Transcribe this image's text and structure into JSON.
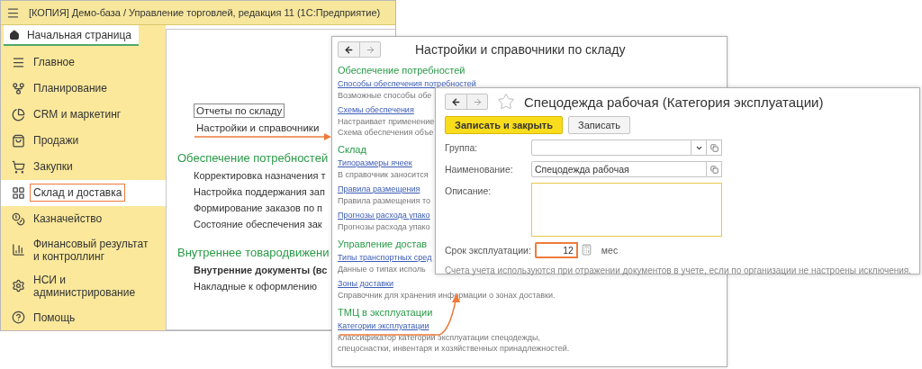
{
  "main_window": {
    "title": "[КОПИЯ] Демо-база / Управление торговлей, редакция 11  (1С:Предприятие)",
    "home_tab": {
      "label": "Начальная страница",
      "selected": true
    },
    "sidebar": {
      "items": [
        {
          "label": "Главное",
          "selected": false
        },
        {
          "label": "Планирование",
          "selected": false
        },
        {
          "label": "CRM и маркетинг",
          "selected": false
        },
        {
          "label": "Продажи",
          "selected": false
        },
        {
          "label": "Закупки",
          "selected": false
        },
        {
          "label": "Склад и доставка",
          "selected": true
        },
        {
          "label": "Казначейство",
          "selected": false
        },
        {
          "label": "Финансовый результат и контроллинг",
          "selected": false
        },
        {
          "label": "НСИ и администрирование",
          "selected": false
        },
        {
          "label": "Помощь",
          "selected": false
        }
      ]
    },
    "content": {
      "links": [
        {
          "label": "Отчеты по складу",
          "focused": true
        },
        {
          "label": "Настройки и справочники",
          "focused": false
        }
      ],
      "sections": [
        {
          "title": "Обеспечение потребностей",
          "items": [
            {
              "label": "Корректировка назначения т",
              "bold": false
            },
            {
              "label": "Настройка поддержания зап",
              "bold": false
            },
            {
              "label": "Формирование заказов по п",
              "bold": false
            },
            {
              "label": "Состояние обеспечения зак",
              "bold": false
            }
          ]
        },
        {
          "title": "Внутреннее товародвижени",
          "items": [
            {
              "label": "Внутренние документы (вс",
              "bold": true
            },
            {
              "label": "Накладные к оформлению",
              "bold": false
            }
          ]
        }
      ]
    }
  },
  "settings_window": {
    "title": "Настройки и справочники по складу",
    "sections": [
      {
        "title": "Обеспечение потребностей",
        "entries": [
          {
            "link": "Способы обеспечения потребностей",
            "description": [
              "Возможные способы обе"
            ]
          },
          {
            "link": "Схемы обеспечения",
            "description": [
              "Настраивает применение",
              "Схема обеспечения объе"
            ]
          }
        ]
      },
      {
        "title": "Склад",
        "entries": [
          {
            "link": "Типоразмеры ячеек",
            "description": [
              "В справочник заносится"
            ]
          },
          {
            "link": "Правила размещения",
            "description": [
              "Правила размещения то"
            ]
          },
          {
            "link": "Прогнозы расхода упако",
            "description": [
              "Прогнозы расхода упако"
            ]
          }
        ]
      },
      {
        "title": "Управление достав",
        "entries": [
          {
            "link": "Типы транспортных сред",
            "description": [
              "Данные о типах исполь"
            ]
          },
          {
            "link": "Зоны доставки",
            "description": [
              "Справочник для хранения информации о зонах доставки."
            ]
          }
        ]
      },
      {
        "title": "ТМЦ в эксплуатации",
        "entries": [
          {
            "link": "Категории эксплуатации",
            "description": [
              "Классификатор категорий эксплуатации спецодежды,",
              "спецоснастки, инвентаря и хозяйственных принадлежностей."
            ]
          }
        ]
      }
    ]
  },
  "item_window": {
    "title": "Спецодежда рабочая (Категория эксплуатации)",
    "favorite": false,
    "buttons": [
      {
        "label": "Записать и закрыть",
        "kind": "primary"
      },
      {
        "label": "Записать",
        "kind": "secondary"
      }
    ],
    "fields": [
      {
        "label": "Группа:",
        "kind": "select",
        "focused": false
      },
      {
        "label": "Наименование:",
        "kind": "text",
        "value": "Спецодежда рабочая",
        "focused": false
      },
      {
        "label": "Описание:",
        "kind": "textarea",
        "focused": true
      }
    ],
    "term": {
      "label": "Срок эксплуатации:",
      "value": "12",
      "unit": "мес",
      "highlighted": true
    },
    "note": "Счета учета используются при отражении документов в учете, если по организации не настроены исключения."
  }
}
